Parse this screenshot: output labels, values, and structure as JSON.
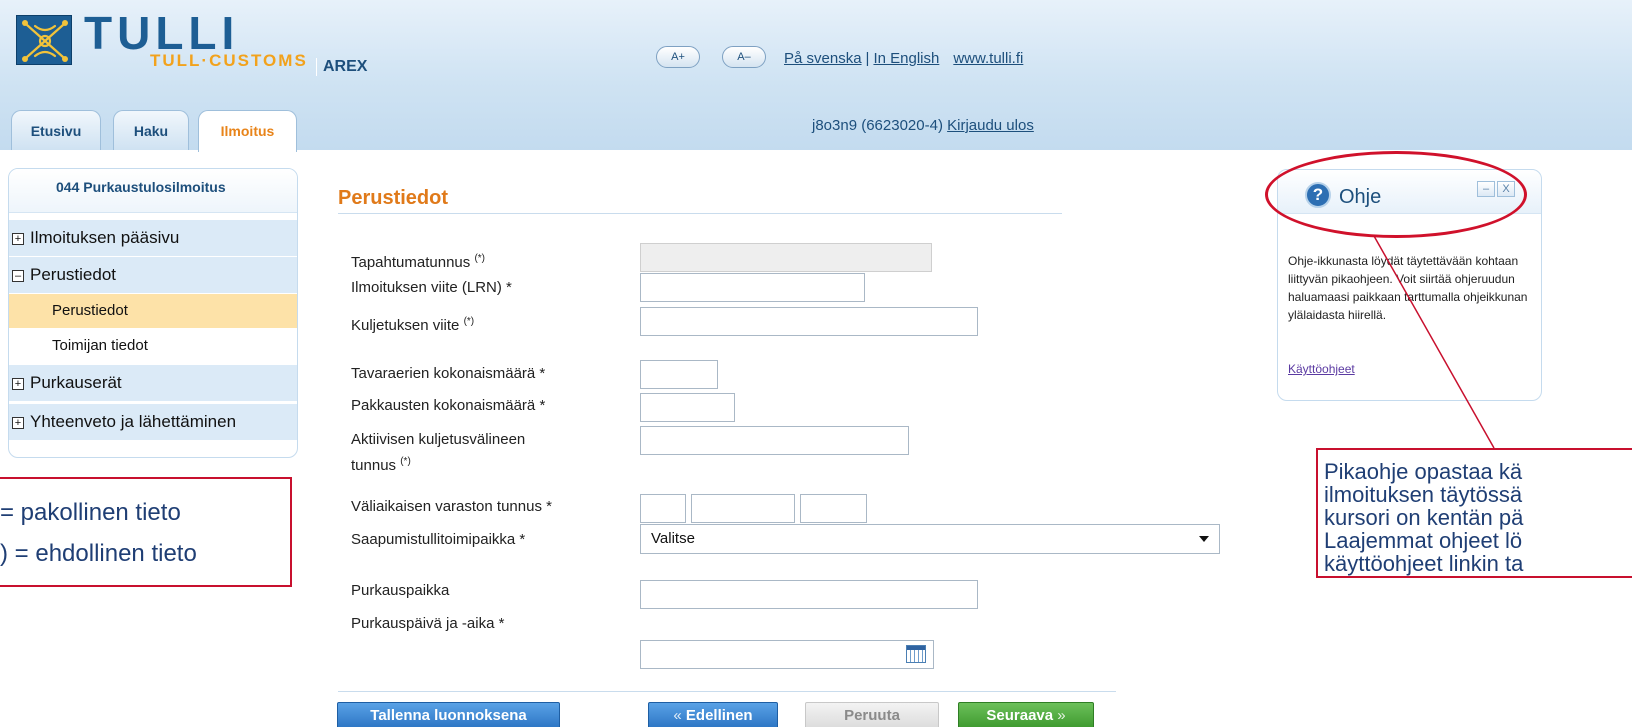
{
  "header": {
    "logo_name": "TULLI",
    "logo_sub": "TULL·CUSTOMS",
    "app_name": "AREX",
    "font_larger": "A+",
    "font_smaller": "A–",
    "lang_swedish": "På svenska",
    "lang_english": "In English",
    "separator": "|",
    "site_link": "www.tulli.fi"
  },
  "tabs": [
    {
      "label": "Etusivu"
    },
    {
      "label": "Haku"
    },
    {
      "label": "Ilmoitus",
      "active": true
    }
  ],
  "user": {
    "id": "j8o3n9 (6623020-4)",
    "logout": "Kirjaudu ulos"
  },
  "nav": {
    "title": "044 Purkaustulosilmoitus",
    "items": [
      {
        "label": "Ilmoituksen pääsivu",
        "state": "+"
      },
      {
        "label": "Perustiedot",
        "state": "–"
      },
      {
        "label": "Perustiedot",
        "sub": true,
        "current": true
      },
      {
        "label": "Toimijan tiedot",
        "sub": true
      },
      {
        "label": "Purkauserät",
        "state": "+"
      },
      {
        "label": "Yhteenveto ja lähettäminen",
        "state": "+"
      }
    ]
  },
  "legend": {
    "line1": "= pakollinen tieto",
    "line2": ") = ehdollinen tieto"
  },
  "form": {
    "section_title": "Perustiedot",
    "fields": {
      "tapahtumatunnus": {
        "label": "Tapahtumatunnus",
        "marker": "(*)",
        "value": ""
      },
      "lrn": {
        "label": "Ilmoituksen viite (LRN) *",
        "value": ""
      },
      "kuljetuksen_viite": {
        "label": "Kuljetuksen viite",
        "marker": "(*)",
        "value": ""
      },
      "tavaraerien_maara": {
        "label": "Tavaraerien kokonaismäärä *",
        "value": ""
      },
      "pakkausten_maara": {
        "label": "Pakkausten kokonaismäärä *",
        "value": ""
      },
      "kuljetusvaline_line1": {
        "label": "Aktiivisen kuljetusvälineen"
      },
      "kuljetusvaline": {
        "label": "tunnus",
        "marker": "(*)",
        "value": ""
      },
      "varasto": {
        "label": "Väliaikaisen varaston tunnus *",
        "values": [
          "",
          "",
          ""
        ]
      },
      "tullitoimipaikka": {
        "label": "Saapumistullitoimipaikka *",
        "selected": "Valitse"
      },
      "purkauspaikka": {
        "label": "Purkauspaikka",
        "value": ""
      },
      "purkauspaiva": {
        "label": "Purkauspäivä ja -aika *",
        "value": ""
      }
    },
    "buttons": {
      "save_draft": "Tallenna luonnoksena",
      "previous_chevron": "«",
      "previous": "Edellinen",
      "cancel": "Peruuta",
      "next": "Seuraava",
      "next_chevron": "»"
    }
  },
  "help": {
    "title": "Ohje",
    "icon": "?",
    "minimize": "–",
    "close": "X",
    "text": "Ohje-ikkunasta löydät täytettävään kohtaan liittyvän pikaohjeen. Voit siirtää ohjeruudun haluamaasi paikkaan tarttumalla ohjeikkunan ylälaidasta hiirellä.",
    "link": "Käyttöohjeet"
  },
  "annotation": {
    "lines": [
      "Pikaohje opastaa kä",
      "ilmoituksen täytössä",
      "kursori on kentän pä",
      "Laajemmat ohjeet lö",
      "käyttöohjeet linkin ta"
    ],
    "color": "#c8102e"
  },
  "colors": {
    "brand_blue": "#1d5e94",
    "accent_orange": "#e07a1a",
    "logo_orange": "#f2a21c",
    "highlight": "#fde2a8"
  },
  "icons": {
    "logo": "customs-emblem-icon",
    "calendar": "calendar-icon",
    "help": "question-icon",
    "dropdown": "chevron-down-icon"
  }
}
